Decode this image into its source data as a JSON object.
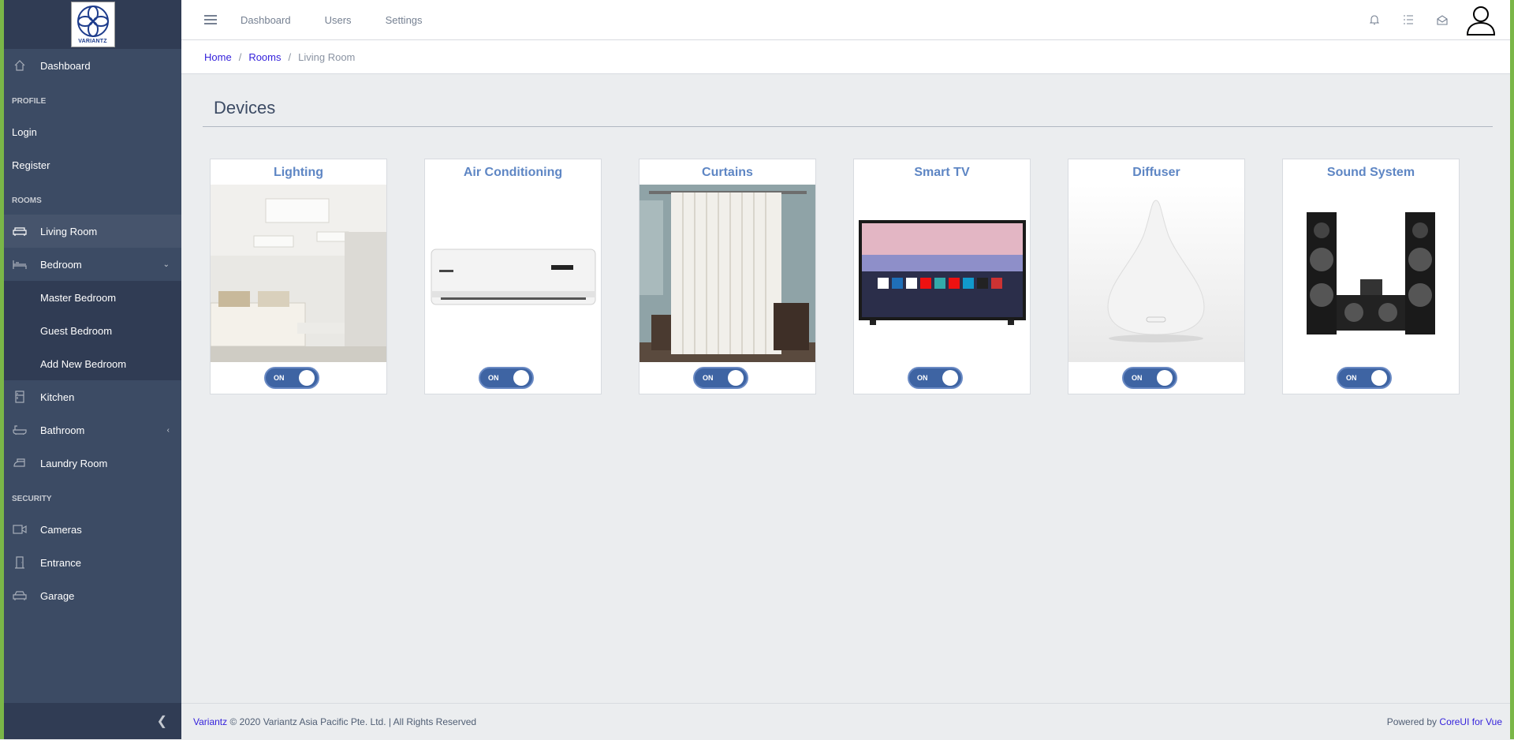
{
  "brand": {
    "logo_text": "VARIANTZ"
  },
  "sidebar": {
    "dashboard": "Dashboard",
    "profile_title": "PROFILE",
    "login": "Login",
    "register": "Register",
    "rooms_title": "ROOMS",
    "living_room": "Living Room",
    "bedroom": "Bedroom",
    "bedroom_sub": [
      "Master Bedroom",
      "Guest Bedroom",
      "Add New Bedroom"
    ],
    "kitchen": "Kitchen",
    "bathroom": "Bathroom",
    "laundry": "Laundry Room",
    "security_title": "SECURITY",
    "cameras": "Cameras",
    "entrance": "Entrance",
    "garage": "Garage"
  },
  "header": {
    "nav": [
      "Dashboard",
      "Users",
      "Settings"
    ]
  },
  "breadcrumb": {
    "home": "Home",
    "rooms": "Rooms",
    "current": "Living Room"
  },
  "main": {
    "title": "Devices"
  },
  "devices": [
    {
      "name": "Lighting",
      "state": "ON"
    },
    {
      "name": "Air Conditioning",
      "state": "ON"
    },
    {
      "name": "Curtains",
      "state": "ON"
    },
    {
      "name": "Smart TV",
      "state": "ON"
    },
    {
      "name": "Diffuser",
      "state": "ON"
    },
    {
      "name": "Sound System",
      "state": "ON"
    }
  ],
  "footer": {
    "company_link": "Variantz",
    "copyright": "© 2020 Variantz Asia Pacific Pte. Ltd. | All Rights Reserved",
    "powered_prefix": "Powered by",
    "powered_link": "CoreUI for Vue"
  },
  "colors": {
    "accent": "#321fdb",
    "sidebar": "#3c4b64",
    "card_title": "#5e86c4",
    "toggle": "#3e64a3",
    "frame": "#7ab648"
  }
}
